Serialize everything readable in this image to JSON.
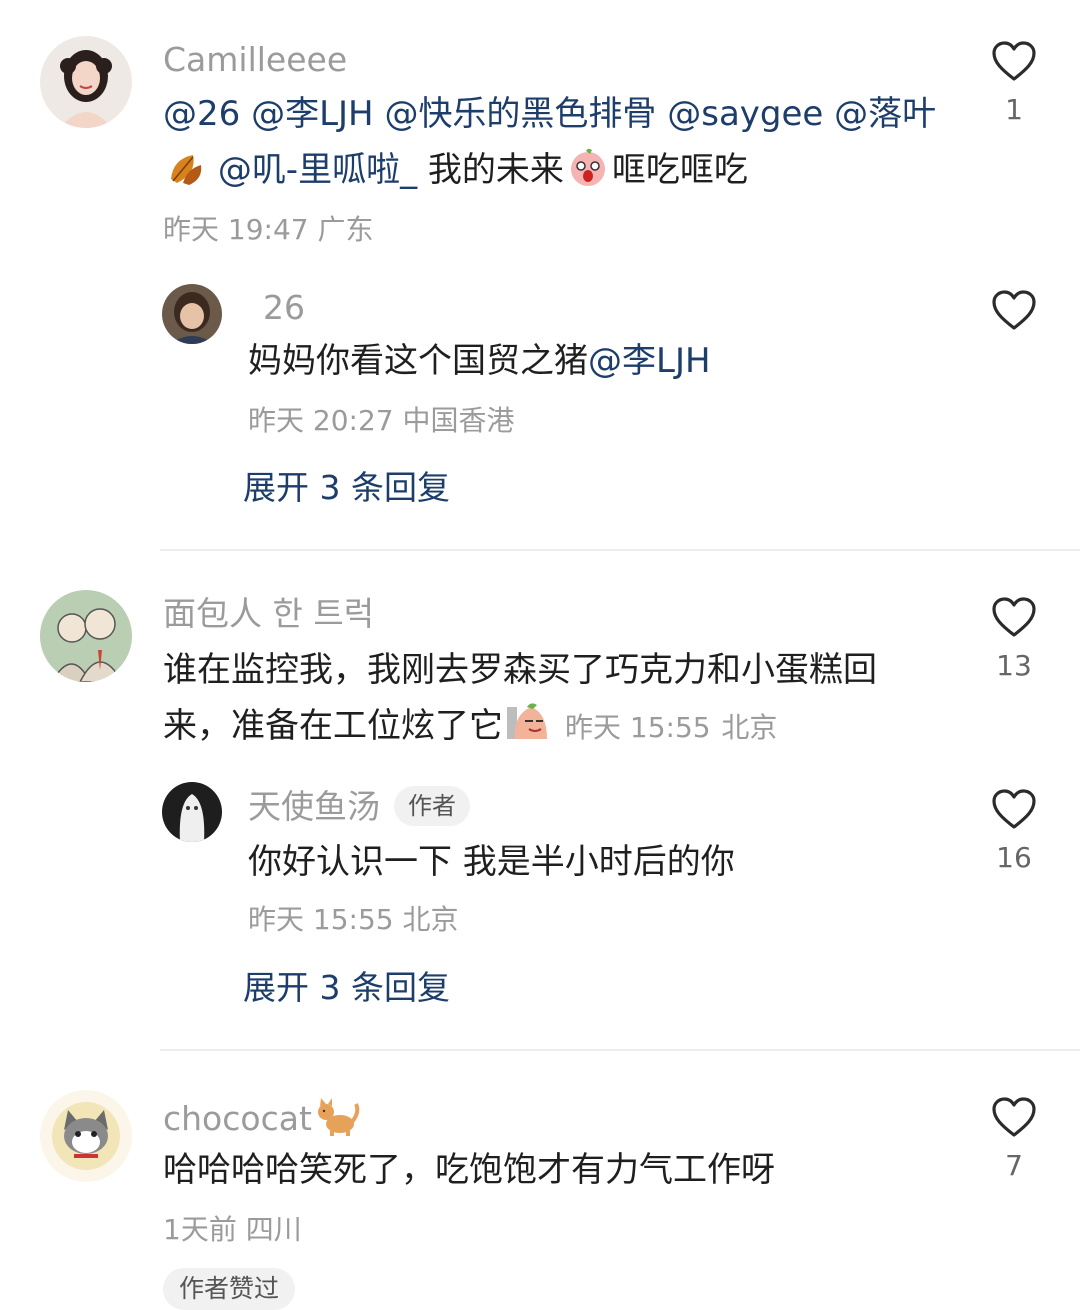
{
  "colors": {
    "mention": "#1d3d6b",
    "username": "#9b9b9b",
    "meta": "#9b9b9b",
    "badge_bg": "#f1f1f1"
  },
  "comments": [
    {
      "user": "Camilleeee",
      "avatar_icon": "girl-avatar",
      "text_parts": [
        "@26",
        "@李LJH",
        "@快乐的黑色排骨",
        "@saygee",
        "@落叶",
        "@叽-里呱啦_",
        "我的未来",
        "哐吃哐吃"
      ],
      "time": "昨天 19:47",
      "location": "广东",
      "likes": "1",
      "reply": {
        "user": "26",
        "avatar_icon": "child-avatar",
        "text": "妈妈你看这个国贸之猪",
        "mention": "@李LJH",
        "time": "昨天 20:27",
        "location": "中国香港"
      },
      "expand": "展开 3 条回复"
    },
    {
      "user": "面包人 한 트럭",
      "avatar_icon": "cartoon-couple-avatar",
      "text_line1": "谁在监控我，我刚去罗森买了巧克力和小蛋糕回",
      "text_line2": "来，准备在工位炫了它",
      "time": "昨天 15:55",
      "location": "北京",
      "likes": "13",
      "reply": {
        "user": "天使鱼汤",
        "badge": "作者",
        "avatar_icon": "white-figure-avatar",
        "text": "你好认识一下 我是半小时后的你",
        "time": "昨天 15:55",
        "location": "北京",
        "likes": "16"
      },
      "expand": "展开 3 条回复"
    },
    {
      "user": "chococat",
      "avatar_icon": "cat-avatar",
      "text": "哈哈哈哈笑死了，吃饱饱才有力气工作呀",
      "time": "1天前",
      "location": "四川",
      "likes": "7",
      "liked_badge": "作者赞过"
    }
  ]
}
